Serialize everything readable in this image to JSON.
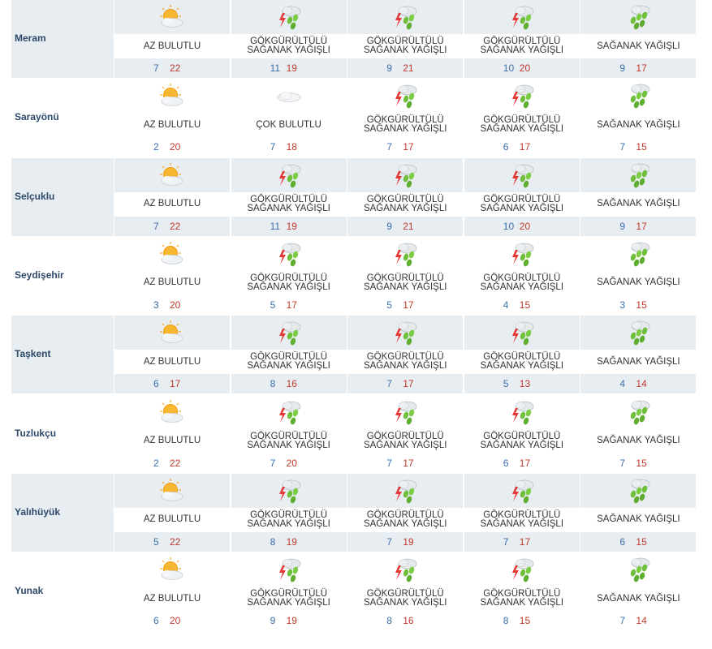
{
  "weather_table": {
    "rows": [
      {
        "city": "Meram",
        "days": [
          {
            "icon": "sun-cloud-icon",
            "desc": "AZ BULUTLU",
            "min": "7",
            "max": "22"
          },
          {
            "icon": "thunder-shower-icon",
            "desc": "GÖKGÜRÜLTÜLÜ SAĞANAK YAĞIŞLI",
            "min": "11",
            "max": "19"
          },
          {
            "icon": "thunder-shower-icon",
            "desc": "GÖKGÜRÜLTÜLÜ SAĞANAK YAĞIŞLI",
            "min": "9",
            "max": "21"
          },
          {
            "icon": "thunder-shower-icon",
            "desc": "GÖKGÜRÜLTÜLÜ SAĞANAK YAĞIŞLI",
            "min": "10",
            "max": "20"
          },
          {
            "icon": "rain-shower-icon",
            "desc": "SAĞANAK YAĞIŞLI",
            "min": "9",
            "max": "17"
          }
        ]
      },
      {
        "city": "Sarayönü",
        "days": [
          {
            "icon": "sun-cloud-icon",
            "desc": "AZ BULUTLU",
            "min": "2",
            "max": "20"
          },
          {
            "icon": "cloudy-icon",
            "desc": "ÇOK BULUTLU",
            "min": "7",
            "max": "18"
          },
          {
            "icon": "thunder-shower-icon",
            "desc": "GÖKGÜRÜLTÜLÜ SAĞANAK YAĞIŞLI",
            "min": "7",
            "max": "17"
          },
          {
            "icon": "thunder-shower-icon",
            "desc": "GÖKGÜRÜLTÜLÜ SAĞANAK YAĞIŞLI",
            "min": "6",
            "max": "17"
          },
          {
            "icon": "rain-shower-icon",
            "desc": "SAĞANAK YAĞIŞLI",
            "min": "7",
            "max": "15"
          }
        ]
      },
      {
        "city": "Selçuklu",
        "days": [
          {
            "icon": "sun-cloud-icon",
            "desc": "AZ BULUTLU",
            "min": "7",
            "max": "22"
          },
          {
            "icon": "thunder-shower-icon",
            "desc": "GÖKGÜRÜLTÜLÜ SAĞANAK YAĞIŞLI",
            "min": "11",
            "max": "19"
          },
          {
            "icon": "thunder-shower-icon",
            "desc": "GÖKGÜRÜLTÜLÜ SAĞANAK YAĞIŞLI",
            "min": "9",
            "max": "21"
          },
          {
            "icon": "thunder-shower-icon",
            "desc": "GÖKGÜRÜLTÜLÜ SAĞANAK YAĞIŞLI",
            "min": "10",
            "max": "20"
          },
          {
            "icon": "rain-shower-icon",
            "desc": "SAĞANAK YAĞIŞLI",
            "min": "9",
            "max": "17"
          }
        ]
      },
      {
        "city": "Seydişehir",
        "days": [
          {
            "icon": "sun-cloud-icon",
            "desc": "AZ BULUTLU",
            "min": "3",
            "max": "20"
          },
          {
            "icon": "thunder-shower-icon",
            "desc": "GÖKGÜRÜLTÜLÜ SAĞANAK YAĞIŞLI",
            "min": "5",
            "max": "17"
          },
          {
            "icon": "thunder-shower-icon",
            "desc": "GÖKGÜRÜLTÜLÜ SAĞANAK YAĞIŞLI",
            "min": "5",
            "max": "17"
          },
          {
            "icon": "thunder-shower-icon",
            "desc": "GÖKGÜRÜLTÜLÜ SAĞANAK YAĞIŞLI",
            "min": "4",
            "max": "15"
          },
          {
            "icon": "rain-shower-icon",
            "desc": "SAĞANAK YAĞIŞLI",
            "min": "3",
            "max": "15"
          }
        ]
      },
      {
        "city": "Taşkent",
        "days": [
          {
            "icon": "sun-cloud-icon",
            "desc": "AZ BULUTLU",
            "min": "6",
            "max": "17"
          },
          {
            "icon": "thunder-shower-icon",
            "desc": "GÖKGÜRÜLTÜLÜ SAĞANAK YAĞIŞLI",
            "min": "8",
            "max": "16"
          },
          {
            "icon": "thunder-shower-icon",
            "desc": "GÖKGÜRÜLTÜLÜ SAĞANAK YAĞIŞLI",
            "min": "7",
            "max": "17"
          },
          {
            "icon": "thunder-shower-icon",
            "desc": "GÖKGÜRÜLTÜLÜ SAĞANAK YAĞIŞLI",
            "min": "5",
            "max": "13"
          },
          {
            "icon": "rain-shower-icon",
            "desc": "SAĞANAK YAĞIŞLI",
            "min": "4",
            "max": "14"
          }
        ]
      },
      {
        "city": "Tuzlukçu",
        "days": [
          {
            "icon": "sun-cloud-icon",
            "desc": "AZ BULUTLU",
            "min": "2",
            "max": "22"
          },
          {
            "icon": "thunder-shower-icon",
            "desc": "GÖKGÜRÜLTÜLÜ SAĞANAK YAĞIŞLI",
            "min": "7",
            "max": "20"
          },
          {
            "icon": "thunder-shower-icon",
            "desc": "GÖKGÜRÜLTÜLÜ SAĞANAK YAĞIŞLI",
            "min": "7",
            "max": "17"
          },
          {
            "icon": "thunder-shower-icon",
            "desc": "GÖKGÜRÜLTÜLÜ SAĞANAK YAĞIŞLI",
            "min": "6",
            "max": "17"
          },
          {
            "icon": "rain-shower-icon",
            "desc": "SAĞANAK YAĞIŞLI",
            "min": "7",
            "max": "15"
          }
        ]
      },
      {
        "city": "Yalıhüyük",
        "days": [
          {
            "icon": "sun-cloud-icon",
            "desc": "AZ BULUTLU",
            "min": "5",
            "max": "22"
          },
          {
            "icon": "thunder-shower-icon",
            "desc": "GÖKGÜRÜLTÜLÜ SAĞANAK YAĞIŞLI",
            "min": "8",
            "max": "19"
          },
          {
            "icon": "thunder-shower-icon",
            "desc": "GÖKGÜRÜLTÜLÜ SAĞANAK YAĞIŞLI",
            "min": "7",
            "max": "19"
          },
          {
            "icon": "thunder-shower-icon",
            "desc": "GÖKGÜRÜLTÜLÜ SAĞANAK YAĞIŞLI",
            "min": "7",
            "max": "17"
          },
          {
            "icon": "rain-shower-icon",
            "desc": "SAĞANAK YAĞIŞLI",
            "min": "6",
            "max": "15"
          }
        ]
      },
      {
        "city": "Yunak",
        "days": [
          {
            "icon": "sun-cloud-icon",
            "desc": "AZ BULUTLU",
            "min": "6",
            "max": "20"
          },
          {
            "icon": "thunder-shower-icon",
            "desc": "GÖKGÜRÜLTÜLÜ SAĞANAK YAĞIŞLI",
            "min": "9",
            "max": "19"
          },
          {
            "icon": "thunder-shower-icon",
            "desc": "GÖKGÜRÜLTÜLÜ SAĞANAK YAĞIŞLI",
            "min": "8",
            "max": "16"
          },
          {
            "icon": "thunder-shower-icon",
            "desc": "GÖKGÜRÜLTÜLÜ SAĞANAK YAĞIŞLI",
            "min": "8",
            "max": "15"
          },
          {
            "icon": "rain-shower-icon",
            "desc": "SAĞANAK YAĞIŞLI",
            "min": "7",
            "max": "14"
          }
        ]
      }
    ]
  },
  "colors": {
    "shaded_row": "#e8edf2",
    "city_name": "#2d4a6b",
    "min_temp": "#3b6ea8",
    "max_temp": "#c0392b"
  }
}
